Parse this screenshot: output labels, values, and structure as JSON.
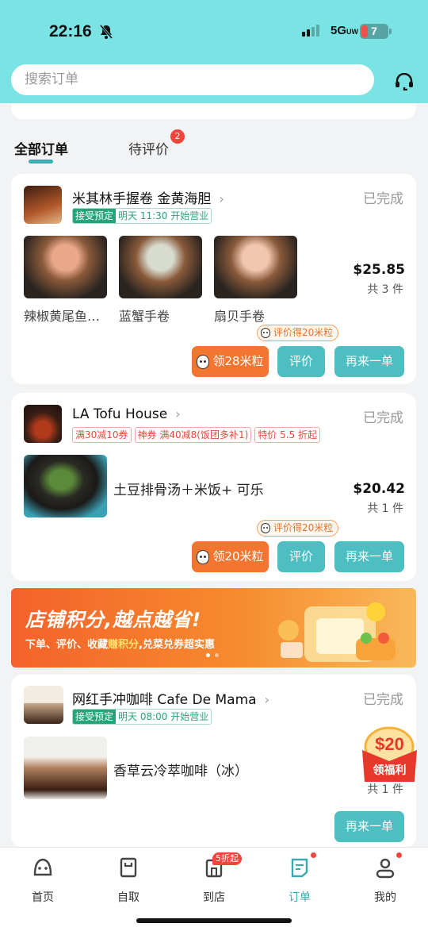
{
  "status_bar": {
    "time": "22:16",
    "network": "5G",
    "network_suffix": "UW",
    "battery": "7"
  },
  "search": {
    "placeholder": "搜索订单"
  },
  "tabs": [
    {
      "label": "全部订单",
      "active": true
    },
    {
      "label": "待评价",
      "badge": "2"
    }
  ],
  "orders": [
    {
      "store": "米其林手握卷 金黄海胆",
      "status": "已完成",
      "tags": [
        {
          "a": "接受预定",
          "b": "明天 11:30 开始营业"
        }
      ],
      "items": [
        "辣椒黄尾鱼…",
        "蓝蟹手卷",
        "扇贝手卷"
      ],
      "price": "$25.85",
      "qty": "共 3 件",
      "tip": "评价得20米粒",
      "reward_button": "领28米粒",
      "review_button": "评价",
      "reorder_button": "再来一单"
    },
    {
      "store": "LA Tofu House",
      "status": "已完成",
      "tags": [
        "满30减10券",
        "神券 满40减8(饭团多补1)",
        "特价 5.5 折起"
      ],
      "item": "土豆排骨汤＋米饭+ 可乐",
      "price": "$20.42",
      "qty": "共 1 件",
      "tip": "评价得20米粒",
      "reward_button": "领20米粒",
      "review_button": "评价",
      "reorder_button": "再来一单"
    },
    {
      "store": "网红手冲咖啡 Cafe De Mama",
      "status": "已完成",
      "tags": [
        {
          "a": "接受预定",
          "b": "明天 08:00 开始营业"
        }
      ],
      "item": "香草云冷萃咖啡（冰）",
      "qty": "共 1 件",
      "coupon": {
        "amount": "$20",
        "label": "领福利"
      },
      "reorder_button": "再来一单"
    }
  ],
  "banner": {
    "title": "店铺积分,越点越省!",
    "sub_pre": "下单、评价、收藏",
    "sub_em": "赚积分",
    "sub_post": ",兑菜兑券超实惠"
  },
  "tabbar": {
    "items": [
      "首页",
      "自取",
      "到店",
      "订单",
      "我的"
    ],
    "badge": "5折起",
    "active": "订单"
  },
  "colors": {
    "header": "#7ae3e3",
    "accent": "#4dbec1",
    "orange": "#f47530",
    "badge": "#f0463c"
  }
}
